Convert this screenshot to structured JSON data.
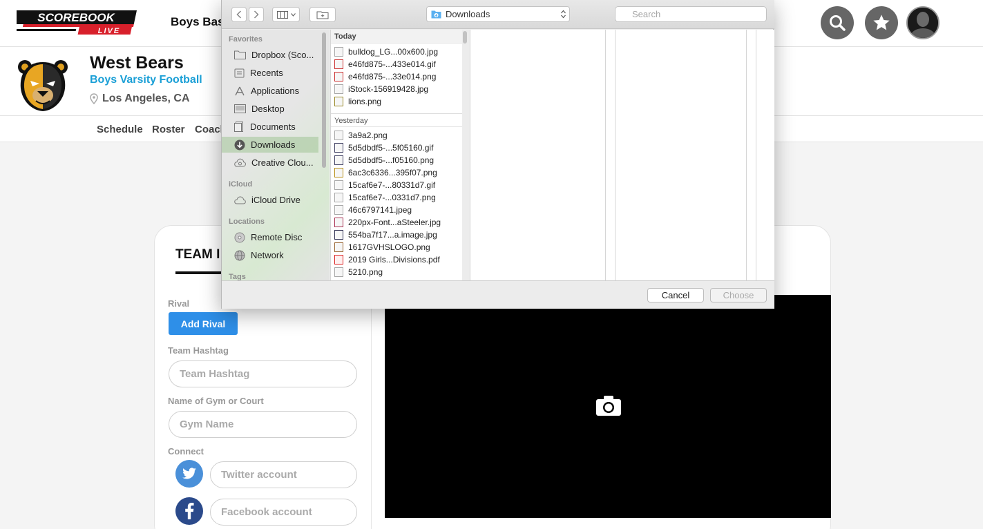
{
  "header": {
    "logo_text_top": "SCOREBOOK",
    "logo_text_bottom": "LIVE",
    "sport_title": "Boys Bas"
  },
  "team": {
    "name": "West Bears",
    "level": "Boys Varsity Football",
    "location": "Los Angeles, CA"
  },
  "nav": {
    "items": [
      "Schedule",
      "Roster",
      "Coach"
    ]
  },
  "card": {
    "title": "TEAM I",
    "rival_label": "Rival",
    "add_rival_label": "Add Rival",
    "hashtag_label": "Team Hashtag",
    "hashtag_placeholder": "Team Hashtag",
    "gym_label": "Name of Gym or Court",
    "gym_placeholder": "Gym Name",
    "connect_label": "Connect",
    "twitter_placeholder": "Twitter account",
    "facebook_placeholder": "Facebook account"
  },
  "dialog": {
    "location": "Downloads",
    "search_placeholder": "Search",
    "sidebar": {
      "favorites_label": "Favorites",
      "favorites": [
        "Dropbox (Sco...",
        "Recents",
        "Applications",
        "Desktop",
        "Documents",
        "Downloads",
        "Creative Clou..."
      ],
      "icloud_label": "iCloud",
      "icloud": [
        "iCloud Drive"
      ],
      "locations_label": "Locations",
      "locations": [
        "Remote Disc",
        "Network"
      ],
      "tags_label": "Tags"
    },
    "today_label": "Today",
    "today_files": [
      "bulldog_LG...00x600.jpg",
      "e46fd875-...433e014.gif",
      "e46fd875-...33e014.png",
      "iStock-156919428.jpg",
      "lions.png"
    ],
    "yesterday_label": "Yesterday",
    "yesterday_files": [
      "3a9a2.png",
      "5d5dbdf5-...5f05160.gif",
      "5d5dbdf5-...f05160.png",
      "6ac3c6336...395f07.png",
      "15caf6e7-...80331d7.gif",
      "15caf6e7-...0331d7.png",
      "46c6797141.jpeg",
      "220px-Font...aSteeler.jpg",
      "554ba7f17...a.image.jpg",
      "1617GVHSLOGO.png",
      "2019 Girls...Divisions.pdf",
      "5210.png"
    ],
    "cancel_label": "Cancel",
    "choose_label": "Choose"
  },
  "colors": {
    "accent_blue": "#2e8fe8",
    "team_blue": "#1a9fd6",
    "twitter": "#4a90d9",
    "facebook": "#2b4a8b",
    "sidebar_selected": "#a0c496"
  }
}
